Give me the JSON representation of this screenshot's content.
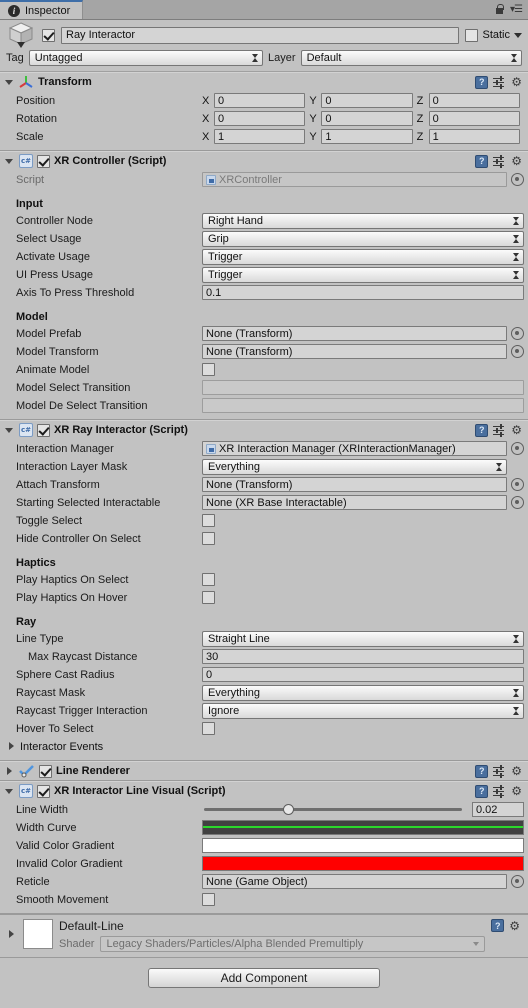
{
  "window": {
    "tab_label": "Inspector",
    "tab_icon": "info-icon",
    "lock_icon": "lock-icon",
    "menu_icon": "hamburger-menu-icon"
  },
  "gameobject": {
    "icon": "prefab-cube-icon",
    "enabled": true,
    "name": "Ray Interactor",
    "static_label": "Static",
    "static_checked": false,
    "tag_label": "Tag",
    "tag_value": "Untagged",
    "layer_label": "Layer",
    "layer_value": "Default"
  },
  "header_icons": {
    "help": "?",
    "preset": "preset-icon",
    "gear": "gear-icon"
  },
  "components": [
    {
      "id": "transform",
      "title": "Transform",
      "icon": "transform-gizmo-icon",
      "expanded": true,
      "has_enable_checkbox": false,
      "rows": [
        {
          "type": "vector3",
          "label": "Position",
          "axes": [
            "X",
            "Y",
            "Z"
          ],
          "values": [
            "0",
            "0",
            "0"
          ]
        },
        {
          "type": "vector3",
          "label": "Rotation",
          "axes": [
            "X",
            "Y",
            "Z"
          ],
          "values": [
            "0",
            "0",
            "0"
          ]
        },
        {
          "type": "vector3",
          "label": "Scale",
          "axes": [
            "X",
            "Y",
            "Z"
          ],
          "values": [
            "1",
            "1",
            "1"
          ]
        }
      ]
    },
    {
      "id": "xr-controller",
      "title": "XR Controller (Script)",
      "icon": "csharp-script-icon",
      "expanded": true,
      "has_enable_checkbox": true,
      "enabled": true,
      "rows": [
        {
          "type": "object",
          "label": "Script",
          "value": "XRController",
          "dim": true,
          "picker": true
        },
        {
          "type": "section",
          "label": "Input"
        },
        {
          "type": "popup",
          "label": "Controller Node",
          "value": "Right Hand"
        },
        {
          "type": "popup",
          "label": "Select Usage",
          "value": "Grip"
        },
        {
          "type": "popup",
          "label": "Activate Usage",
          "value": "Trigger"
        },
        {
          "type": "popup",
          "label": "UI Press Usage",
          "value": "Trigger"
        },
        {
          "type": "text",
          "label": "Axis To Press Threshold",
          "value": "0.1"
        },
        {
          "type": "section",
          "label": "Model"
        },
        {
          "type": "object",
          "label": "Model Prefab",
          "value": "None (Transform)",
          "picker": true
        },
        {
          "type": "object",
          "label": "Model Transform",
          "value": "None (Transform)",
          "picker": true
        },
        {
          "type": "checkbox",
          "label": "Animate Model",
          "checked": false
        },
        {
          "type": "text",
          "label": "Model Select Transition",
          "value": "",
          "empty": true
        },
        {
          "type": "text",
          "label": "Model De Select Transition",
          "value": "",
          "empty": true
        }
      ]
    },
    {
      "id": "xr-ray-interactor",
      "title": "XR Ray Interactor (Script)",
      "icon": "csharp-script-icon",
      "expanded": true,
      "has_enable_checkbox": true,
      "enabled": true,
      "rows": [
        {
          "type": "object",
          "label": "Interaction Manager",
          "value": "XR Interaction Manager (XRInteractionManager)",
          "obj_icon": true,
          "picker": true
        },
        {
          "type": "popup",
          "label": "Interaction Layer Mask",
          "value": "Everything"
        },
        {
          "type": "object",
          "label": "Attach Transform",
          "value": "None (Transform)",
          "picker": true
        },
        {
          "type": "object",
          "label": "Starting Selected Interactable",
          "value": "None (XR Base Interactable)",
          "picker": true
        },
        {
          "type": "checkbox",
          "label": "Toggle Select",
          "checked": false
        },
        {
          "type": "checkbox",
          "label": "Hide Controller On Select",
          "checked": false
        },
        {
          "type": "section",
          "label": "Haptics"
        },
        {
          "type": "checkbox",
          "label": "Play Haptics On Select",
          "checked": false
        },
        {
          "type": "checkbox",
          "label": "Play Haptics On Hover",
          "checked": false
        },
        {
          "type": "section",
          "label": "Ray"
        },
        {
          "type": "popup",
          "label": "Line Type",
          "value": "Straight Line"
        },
        {
          "type": "text",
          "label": "Max Raycast Distance",
          "value": "30",
          "indent": true
        },
        {
          "type": "text",
          "label": "Sphere Cast Radius",
          "value": "0"
        },
        {
          "type": "popup",
          "label": "Raycast Mask",
          "value": "Everything"
        },
        {
          "type": "popup",
          "label": "Raycast Trigger Interaction",
          "value": "Ignore"
        },
        {
          "type": "checkbox",
          "label": "Hover To Select",
          "checked": false
        },
        {
          "type": "foldout",
          "label": "Interactor Events",
          "expanded": false
        }
      ]
    },
    {
      "id": "line-renderer",
      "title": "Line Renderer",
      "icon": "line-renderer-icon",
      "expanded": false,
      "has_enable_checkbox": true,
      "enabled": true,
      "rows": []
    },
    {
      "id": "xr-interactor-line-visual",
      "title": "XR Interactor Line Visual (Script)",
      "icon": "csharp-script-icon",
      "expanded": true,
      "has_enable_checkbox": true,
      "enabled": true,
      "rows": [
        {
          "type": "slider",
          "label": "Line Width",
          "value": "0.02",
          "percent": 33
        },
        {
          "type": "curve",
          "label": "Width Curve",
          "curve_bg": "#414141",
          "curve_color": "#2bd72b"
        },
        {
          "type": "gradient",
          "label": "Valid Color Gradient",
          "color": "#ffffff"
        },
        {
          "type": "gradient",
          "label": "Invalid Color Gradient",
          "color": "#ff0000"
        },
        {
          "type": "object",
          "label": "Reticle",
          "value": "None (Game Object)",
          "picker": true
        },
        {
          "type": "checkbox",
          "label": "Smooth Movement",
          "checked": false
        }
      ]
    }
  ],
  "material": {
    "name": "Default-Line",
    "swatch_color": "#ffffff",
    "shader_label": "Shader",
    "shader_value": "Legacy Shaders/Particles/Alpha Blended Premultiply",
    "expanded": false
  },
  "footer": {
    "add_component_label": "Add Component"
  }
}
